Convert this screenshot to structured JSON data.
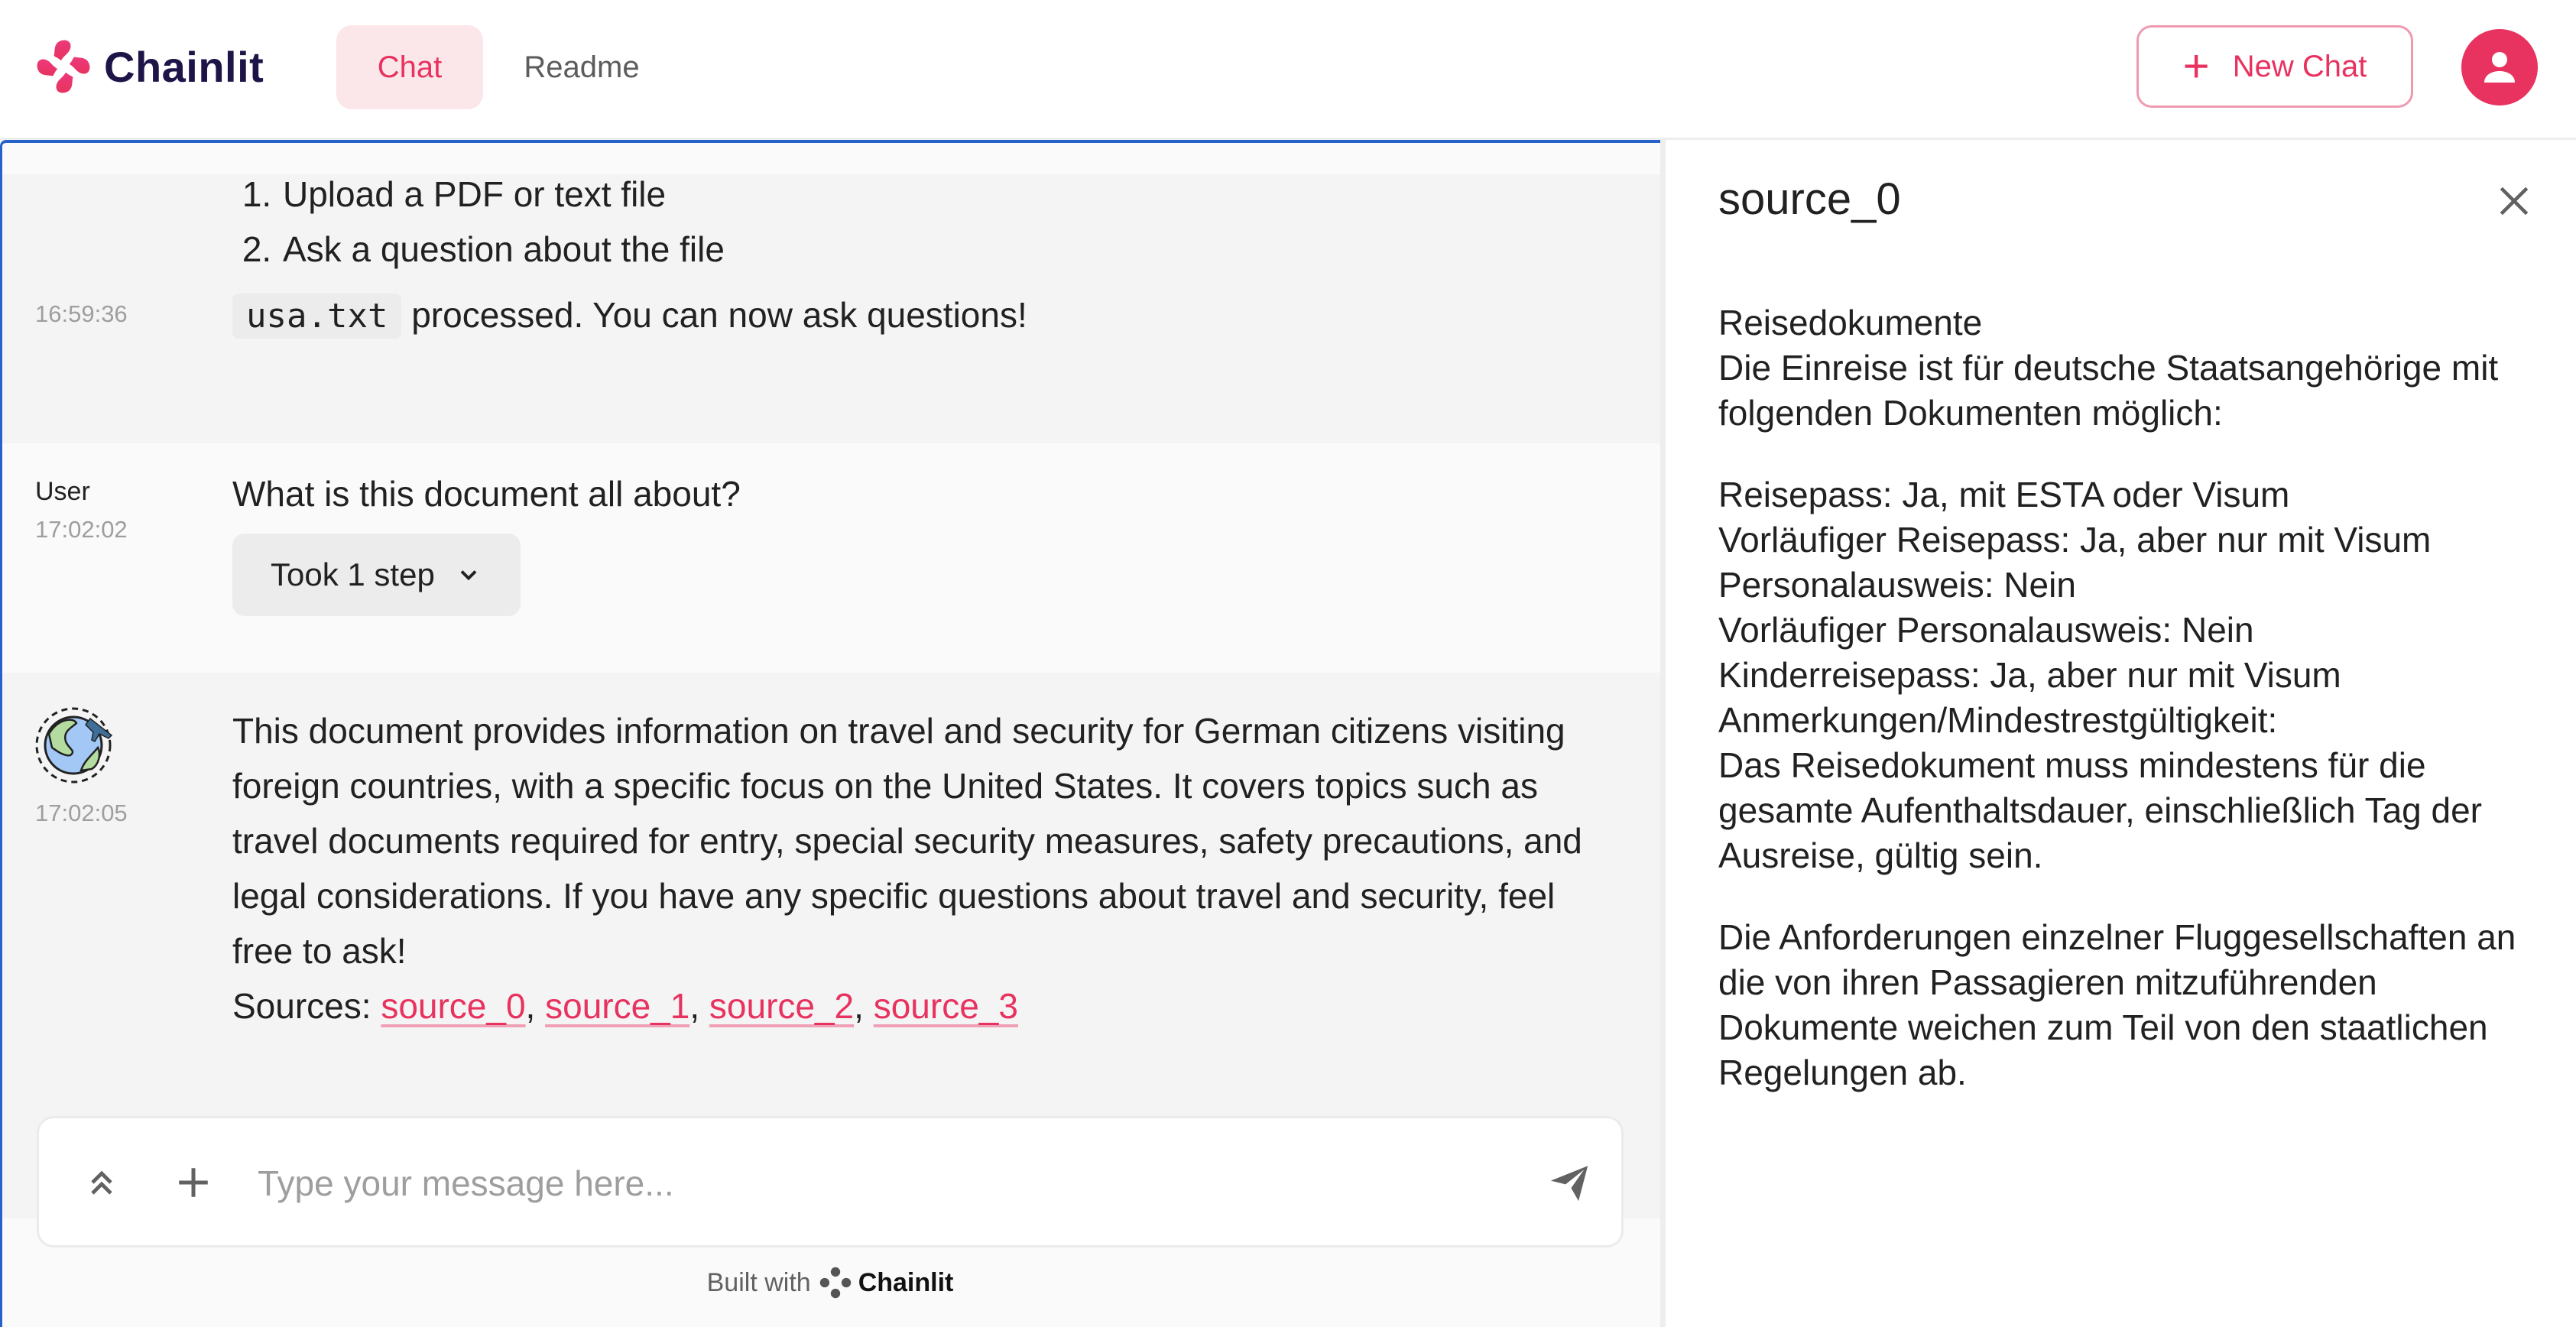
{
  "header": {
    "brand": "Chainlit",
    "tabs": [
      {
        "label": "Chat",
        "active": true
      },
      {
        "label": "Readme",
        "active": false
      }
    ],
    "new_chat_label": "New Chat",
    "accent_color": "#e8325f"
  },
  "chat": {
    "messages": [
      {
        "author": "",
        "time": "16:59:36",
        "list_items": [
          "Upload a PDF or text file",
          "Ask a question about the file"
        ],
        "file_name": "usa.txt",
        "text": "processed. You can now ask questions!"
      },
      {
        "author": "User",
        "time": "17:02:02",
        "text": "What is this document all about?",
        "step_label": "Took 1 step"
      },
      {
        "author": "assistant",
        "avatar_icon": "globe-airplane-icon",
        "time": "17:02:05",
        "text": "This document provides information on travel and security for German citizens visiting foreign countries, with a specific focus on the United States. It covers topics such as travel documents required for entry, special security measures, safety precautions, and legal considerations. If you have any specific questions about travel and security, feel free to ask!",
        "sources_label": "Sources:",
        "sources": [
          "source_0",
          "source_1",
          "source_2",
          "source_3"
        ]
      }
    ],
    "input": {
      "placeholder": "Type your message here...",
      "value": ""
    },
    "footer": {
      "built_with": "Built with",
      "brand": "Chainlit"
    }
  },
  "side_panel": {
    "title": "source_0",
    "paragraphs": [
      [
        "Reisedokumente",
        "Die Einreise ist für deutsche Staatsangehörige mit folgenden Dokumenten möglich:"
      ],
      [
        "Reisepass: Ja, mit ESTA oder Visum",
        "Vorläufiger Reisepass: Ja, aber nur mit Visum",
        "Personalausweis: Nein",
        "Vorläufiger Personalausweis: Nein",
        "Kinderreisepass: Ja, aber nur mit Visum",
        "Anmerkungen/Mindestrestgültigkeit:",
        "Das Reisedokument muss mindestens für die gesamte Aufenthaltsdauer, einschließlich Tag der Ausreise, gültig sein."
      ],
      [
        "Die Anforderungen einzelner Fluggesellschaften an die von ihren Passagieren mitzuführenden Dokumente weichen zum Teil von den staatlichen Regelungen ab."
      ]
    ]
  }
}
